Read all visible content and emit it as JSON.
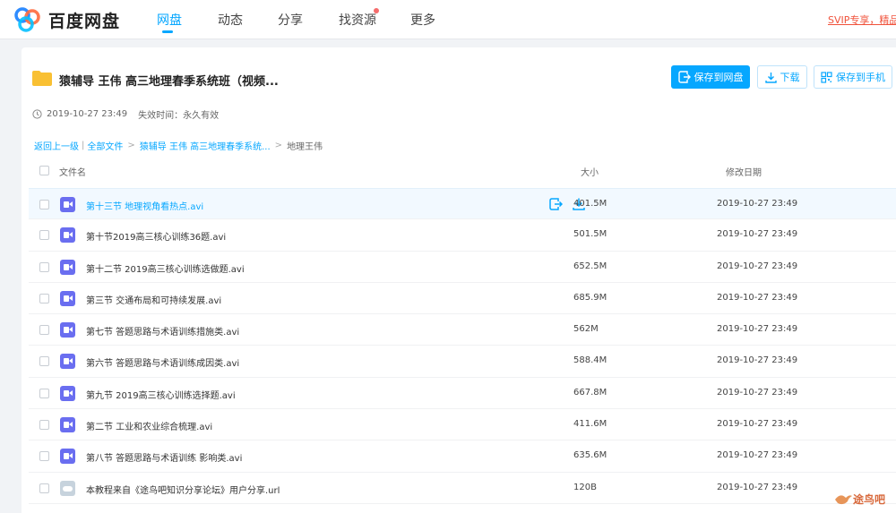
{
  "nav": {
    "brand": "百度网盘",
    "items": [
      "网盘",
      "动态",
      "分享",
      "找资源",
      "更多"
    ],
    "active": "网盘",
    "promo": "SVIP专享，精品好"
  },
  "share": {
    "title": "猿辅导 王伟 高三地理春季系统班（视频...",
    "created": "2019-10-27 23:49",
    "expiry": "失效时间：永久有效",
    "buttons": {
      "save_to_disk": "保存到网盘",
      "download": "下载",
      "save_to_phone": "保存到手机"
    }
  },
  "breadcrumb": {
    "back": "返回上一级",
    "all": "全部文件",
    "parent": "猿辅导 王伟 高三地理春季系统...",
    "current": "地理王伟"
  },
  "table": {
    "headers": {
      "name": "文件名",
      "size": "大小",
      "date": "修改日期"
    },
    "rows": [
      {
        "name": "第十三节 地理视角看热点.avi",
        "size": "401.5M",
        "date": "2019-10-27 23:49",
        "type": "video"
      },
      {
        "name": "第十节2019高三核心训练36题.avi",
        "size": "501.5M",
        "date": "2019-10-27 23:49",
        "type": "video"
      },
      {
        "name": "第十二节 2019高三核心训练选做题.avi",
        "size": "652.5M",
        "date": "2019-10-27 23:49",
        "type": "video"
      },
      {
        "name": "第三节 交通布局和可持续发展.avi",
        "size": "685.9M",
        "date": "2019-10-27 23:49",
        "type": "video"
      },
      {
        "name": "第七节 答题思路与术语训练措施类.avi",
        "size": "562M",
        "date": "2019-10-27 23:49",
        "type": "video"
      },
      {
        "name": "第六节 答题思路与术语训练成因类.avi",
        "size": "588.4M",
        "date": "2019-10-27 23:49",
        "type": "video"
      },
      {
        "name": "第九节 2019高三核心训练选择题.avi",
        "size": "667.8M",
        "date": "2019-10-27 23:49",
        "type": "video"
      },
      {
        "name": "第二节 工业和农业综合梳理.avi",
        "size": "411.6M",
        "date": "2019-10-27 23:49",
        "type": "video"
      },
      {
        "name": "第八节 答题思路与术语训练 影响类.avi",
        "size": "635.6M",
        "date": "2019-10-27 23:49",
        "type": "video"
      },
      {
        "name": "本教程来自《途鸟吧知识分享论坛》用户分享.url",
        "size": "120B",
        "date": "2019-10-27 23:49",
        "type": "url"
      }
    ]
  },
  "watermark": "途鸟吧",
  "colors": {
    "accent": "#06a7ff",
    "video_icon": "#6a6ef0",
    "promo": "#f0523b",
    "folder": "#f9c033"
  }
}
